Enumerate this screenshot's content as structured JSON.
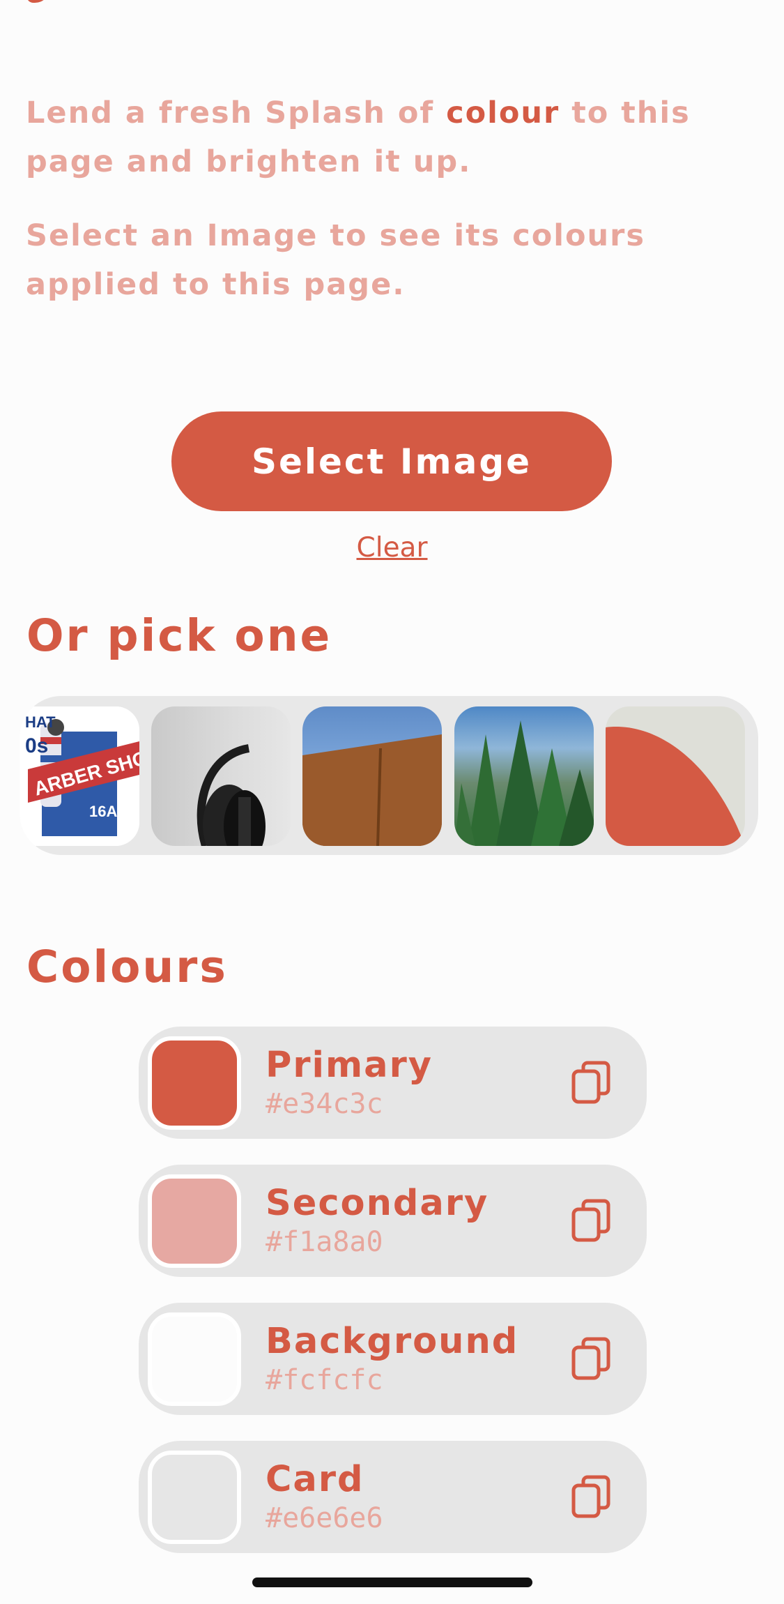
{
  "intro": {
    "p1_before": "Lend a fresh Splash of ",
    "p1_highlight": "colour",
    "p1_after": " to this page and brighten it up.",
    "p2": "Select an Image to see its colours applied to this page."
  },
  "actions": {
    "select_label": "Select Image",
    "clear_label": "Clear"
  },
  "picker": {
    "title": "Or pick one",
    "thumbnails": [
      {
        "name": "barber-shop-sign",
        "text_lines": [
          "HAT",
          "0s",
          "ARBER SHOP",
          "16A"
        ]
      },
      {
        "name": "headphones"
      },
      {
        "name": "blue-sky-wood"
      },
      {
        "name": "forest"
      },
      {
        "name": "red-curve-abstract"
      }
    ]
  },
  "colours": {
    "title": "Colours",
    "items": [
      {
        "name": "Primary",
        "hex": "#e34c3c",
        "swatch": "#d45a44"
      },
      {
        "name": "Secondary",
        "hex": "#f1a8a0",
        "swatch": "#e6a8a2"
      },
      {
        "name": "Background",
        "hex": "#fcfcfc",
        "swatch": "#fcfcfc"
      },
      {
        "name": "Card",
        "hex": "#e6e6e6",
        "swatch": "#e6e6e6"
      }
    ]
  },
  "theme": {
    "accent": "#d45a44",
    "accent_light": "#e8a69c",
    "background": "#fcfcfc",
    "card": "#e6e6e6"
  },
  "icons": {
    "copy": "copy-icon"
  }
}
